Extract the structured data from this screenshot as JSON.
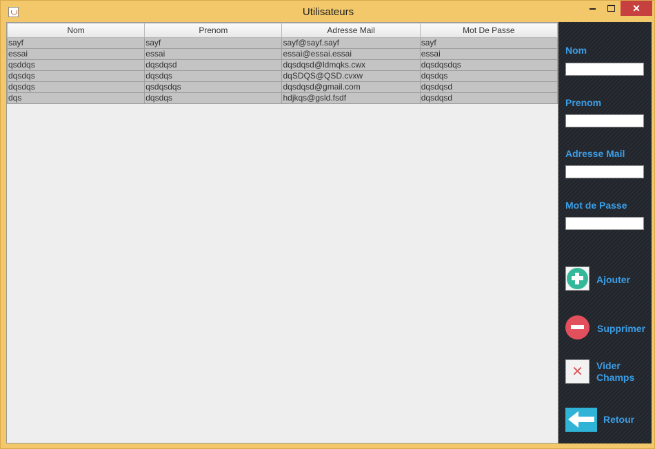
{
  "window": {
    "title": "Utilisateurs",
    "close_glyph": "✕"
  },
  "table": {
    "columns": [
      "Nom",
      "Prenom",
      "Adresse Mail",
      "Mot De Passe"
    ],
    "rows": [
      [
        "sayf",
        "sayf",
        "sayf@sayf.sayf",
        "sayf"
      ],
      [
        "essai",
        "essai",
        "essai@essai.essai",
        "essai"
      ],
      [
        "qsddqs",
        "dqsdqsd",
        "dqsdqsd@ldmqks.cwx",
        "dqsdqsdqs"
      ],
      [
        "dqsdqs",
        "dqsdqs",
        "dqSDQS@QSD.cvxw",
        "dqsdqs"
      ],
      [
        "dqsdqs",
        "qsdqsdqs",
        "dqsdqsd@gmail.com",
        "dqsdqsd"
      ],
      [
        "dqs",
        "dqsdqs",
        "hdjkqs@gsld.fsdf",
        "dqsdqsd"
      ]
    ]
  },
  "form": {
    "nom_label": "Nom",
    "nom_value": "",
    "prenom_label": "Prenom",
    "prenom_value": "",
    "mail_label": "Adresse Mail",
    "mail_value": "",
    "pass_label": "Mot de Passe",
    "pass_value": ""
  },
  "actions": {
    "add_label": "Ajouter",
    "delete_label": "Supprimer",
    "clear_line1": "Vider",
    "clear_line2": "Champs",
    "clear_glyph": "✕",
    "back_label": "Retour"
  },
  "icons": {
    "app": "java-cup-icon",
    "add": "plus-circle-icon",
    "delete": "minus-circle-icon",
    "clear": "x-icon",
    "back": "arrow-left-icon"
  },
  "colors": {
    "window_frame": "#f2c86b",
    "sidebar_bg": "#20242b",
    "label_blue": "#3c9ee6",
    "row_bg": "#c4c4c4",
    "close_red": "#c74040",
    "add_green": "#34b89a",
    "delete_red": "#e2505d",
    "back_blue": "#2fb3d6"
  }
}
